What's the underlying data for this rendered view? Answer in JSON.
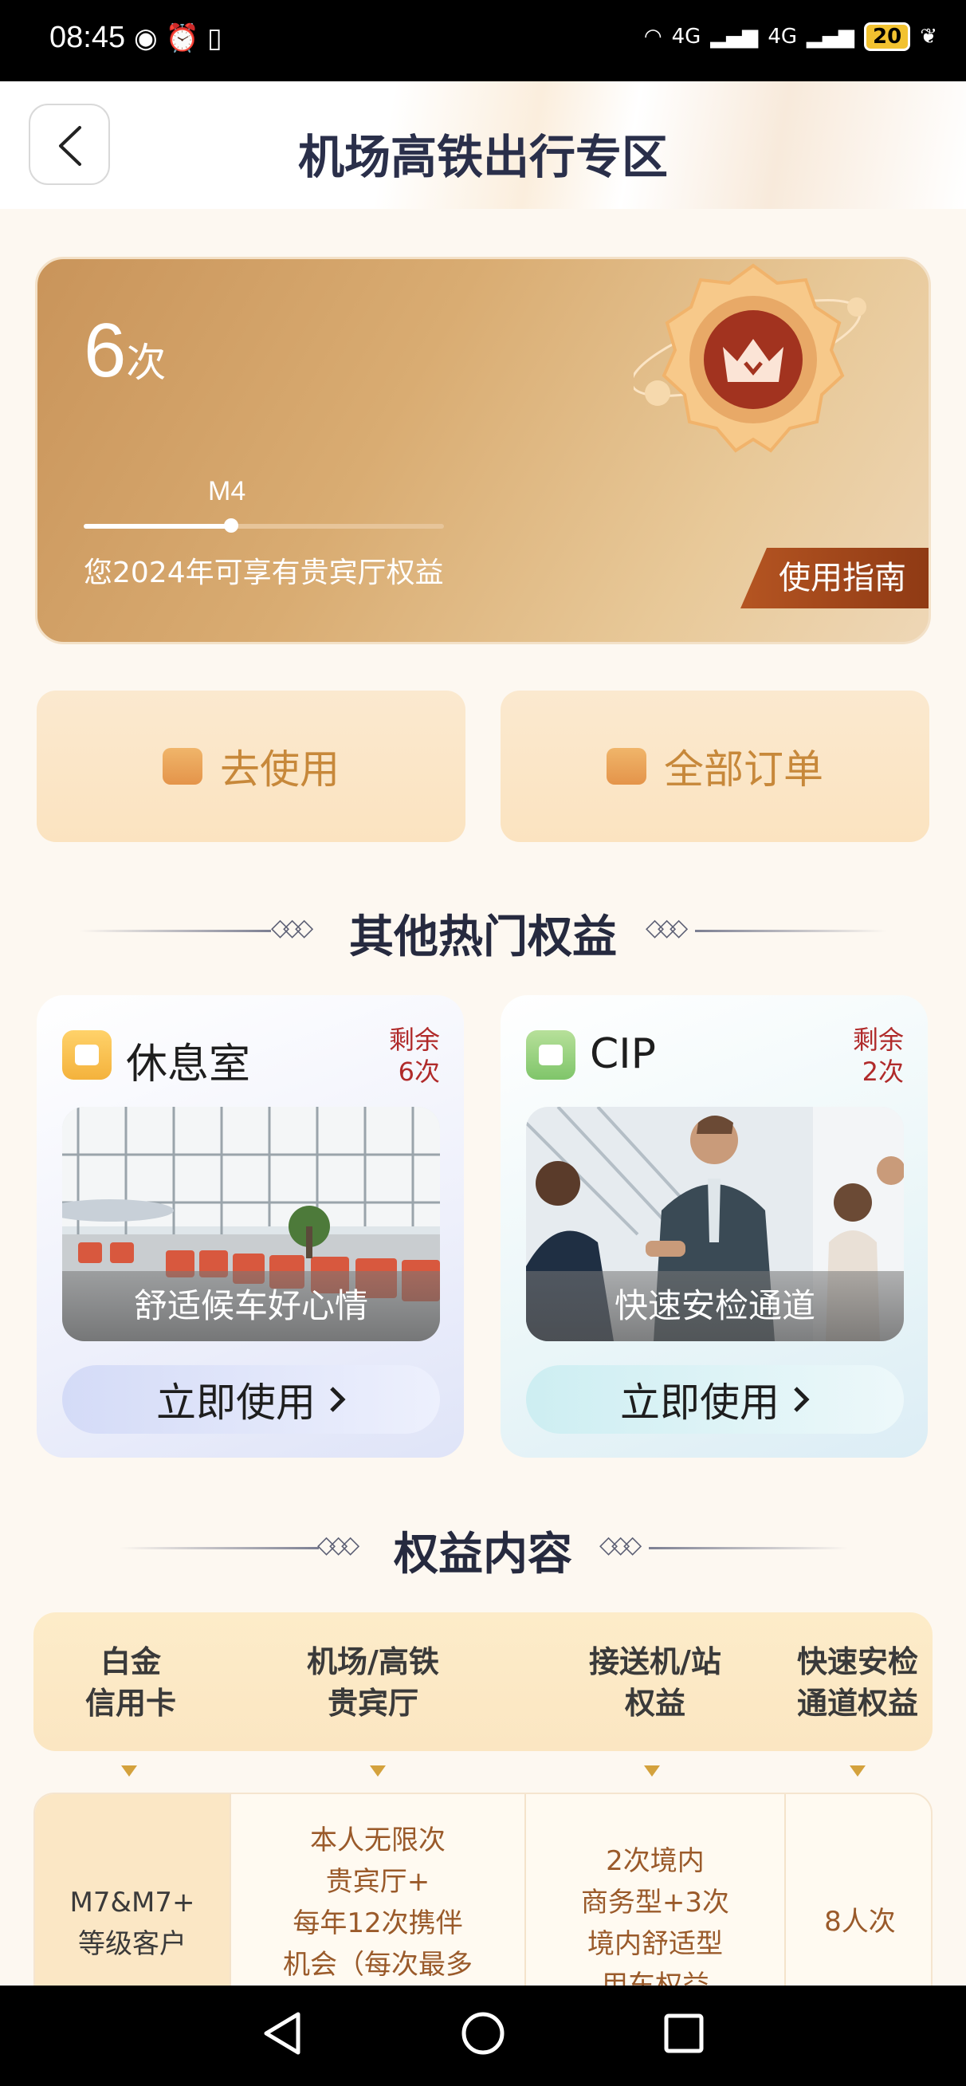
{
  "status_bar": {
    "time": "08:45",
    "battery": "20",
    "net1": "4G",
    "net2": "4G"
  },
  "header": {
    "title": "机场高铁出行专区"
  },
  "hero": {
    "count_number": "6",
    "count_unit": "次",
    "level": "M4",
    "progress_fraction": 0.41,
    "description": "您2024年可享有贵宾厅权益",
    "guide_button": "使用指南"
  },
  "actions": {
    "use": "去使用",
    "orders": "全部订单"
  },
  "hot_section": {
    "title": "其他热门权益"
  },
  "benefits": [
    {
      "name": "休息室",
      "remain_label": "剩余",
      "remain_count": "6次",
      "caption": "舒适候车好心情",
      "button": "立即使用"
    },
    {
      "name": "CIP",
      "remain_label": "剩余",
      "remain_count": "2次",
      "caption": "快速安检通道",
      "button": "立即使用"
    }
  ],
  "content_section": {
    "title": "权益内容"
  },
  "table": {
    "headers": [
      {
        "line1": "白金",
        "line2": "信用卡"
      },
      {
        "line1": "机场/高铁",
        "line2": "贵宾厅"
      },
      {
        "line1": "接送机/站",
        "line2": "权益"
      },
      {
        "line1": "快速安检",
        "line2": "通道权益"
      }
    ],
    "row1": {
      "tier_line1": "M7&M7+",
      "tier_line2": "等级客户",
      "lounge_lines": [
        "本人无限次",
        "贵宾厅+",
        "每年12次携伴",
        "机会（每次最多"
      ],
      "transfer_lines": [
        "2次境内",
        "商务型+3次",
        "境内舒适型",
        "用车权益"
      ],
      "fasttrack": "8人次"
    }
  },
  "colors": {
    "accent_gold": "#c9945a",
    "deep_red": "#9b3a18",
    "title_navy": "#2a2f4a"
  }
}
